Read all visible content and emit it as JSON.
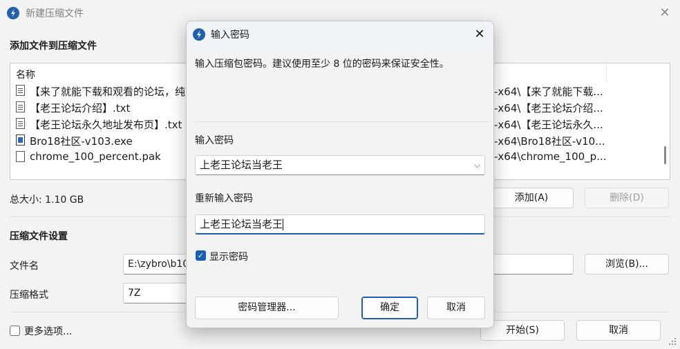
{
  "main_window": {
    "title": "新建压缩文件",
    "section_add": "添加文件到压缩文件",
    "file_list": {
      "column_name": "名称",
      "rows": [
        {
          "name": "【来了就能下载和观看的论坛，纯",
          "path": "-x64\\【来了就能下载...",
          "icon": "text-file-icon"
        },
        {
          "name": "【老王论坛介绍】.txt",
          "path": "-x64\\【老王论坛介绍...",
          "icon": "text-file-icon"
        },
        {
          "name": "【老王论坛永久地址发布页】.txt",
          "path": "-x64\\【老王论坛永久...",
          "icon": "text-file-icon"
        },
        {
          "name": "Bro18社区-v103.exe",
          "path": "-x64\\Bro18社区-v10...",
          "icon": "exe-file-icon"
        },
        {
          "name": "chrome_100_percent.pak",
          "path": "-x64\\chrome_100_p...",
          "icon": "blank-file-icon"
        }
      ]
    },
    "total_size": "总大小: 1.10 GB",
    "add_button": "添加(A)",
    "delete_button": "删除(D)",
    "section_settings": "压缩文件设置",
    "filename_label": "文件名",
    "filename_value": "E:\\zybro\\b10",
    "browse_button": "浏览(B)...",
    "format_label": "压缩格式",
    "format_value": "7Z",
    "more_options": "更多选项...",
    "start_button": "开始(S)",
    "cancel_button": "取消"
  },
  "dialog": {
    "title": "输入密码",
    "description": "输入压缩包密码。建议使用至少 8 位的密码来保证安全性。",
    "password_label": "输入密码",
    "password_value": "上老王论坛当老王",
    "reenter_label": "重新输入密码",
    "reenter_value": "上老王论坛当老王",
    "show_password_label": "显示密码",
    "show_password_checked": true,
    "password_manager_button": "密码管理器...",
    "ok_button": "确定",
    "cancel_button": "取消"
  },
  "colors": {
    "accent": "#1a5fb4",
    "logo": "#1f5fae",
    "window_bg": "#f3f3f3"
  }
}
